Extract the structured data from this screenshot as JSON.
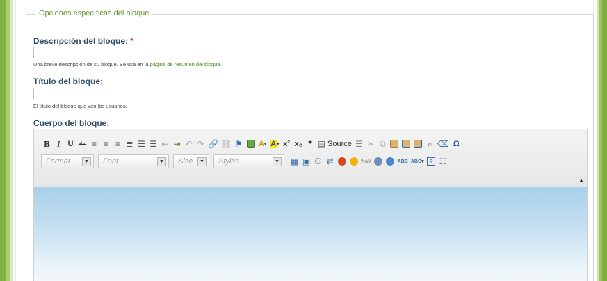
{
  "fieldset": {
    "legend": "Opciones específicas del bloque"
  },
  "description": {
    "label": "Descripción del bloque:",
    "required_mark": "*",
    "value": "",
    "help_before": "Una breve descripción de su bloque. Se usa en la ",
    "help_link": "página de resumen del bloque",
    "help_after": "."
  },
  "title": {
    "label": "Título del bloque:",
    "value": "",
    "help": "El título del bloque que ven los usuarios."
  },
  "body": {
    "label": "Cuerpo del bloque:"
  },
  "toolbar": {
    "bold": "B",
    "italic": "I",
    "underline": "U",
    "strike": "abc",
    "superscript": "x²",
    "subscript": "x₂",
    "blockquote": "❞",
    "source": "Source",
    "special_char": "Ω",
    "format": "Format",
    "font": "Font",
    "size": "Size",
    "styles": "Styles",
    "spell1": "ABC",
    "spell2": "ABC",
    "help": "?",
    "text_color": "A",
    "bg_color": "A"
  },
  "colors": {
    "accent_green": "#7fb040",
    "legend_green": "#5a9a28",
    "label_blue": "#2f4d6b",
    "required_red": "#e03030"
  }
}
